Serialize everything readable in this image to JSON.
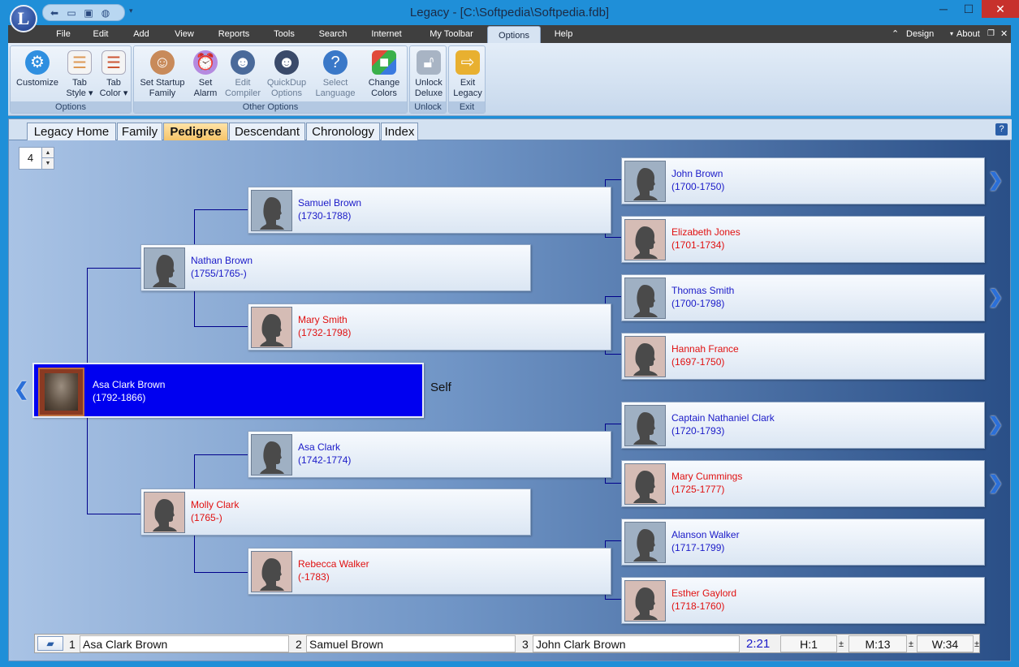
{
  "window": {
    "title": "Legacy - [C:\\Softpedia\\Softpedia.fdb]",
    "logo_letter": "L",
    "min": "─",
    "max": "☐",
    "close": "✕"
  },
  "qat": {
    "icons": [
      "back-arrow-icon",
      "folder-icon",
      "monitor-icon",
      "globe-icon"
    ],
    "dropdown": "▾"
  },
  "menu": {
    "items": [
      "File",
      "Edit",
      "Add",
      "View",
      "Reports",
      "Tools",
      "Search",
      "Internet",
      "My Toolbar",
      "Options",
      "Help"
    ],
    "active": "Options",
    "design": "Design",
    "about": "About",
    "caret": "⌃"
  },
  "ribbon": {
    "groups": [
      {
        "label": "Options",
        "buttons": [
          {
            "line1": "Customize",
            "line2": "",
            "icon": "gear-icon"
          },
          {
            "line1": "Tab",
            "line2": "Style ▾",
            "icon": "tab-style-icon"
          },
          {
            "line1": "Tab",
            "line2": "Color ▾",
            "icon": "tab-color-icon"
          }
        ]
      },
      {
        "label": "Other Options",
        "buttons": [
          {
            "line1": "Set Startup",
            "line2": "Family",
            "icon": "family-icon"
          },
          {
            "line1": "Set",
            "line2": "Alarm",
            "icon": "alarm-clock-icon"
          },
          {
            "line1": "Edit",
            "line2": "Compiler",
            "icon": "compiler-icon"
          },
          {
            "line1": "QuickDup",
            "line2": "Options",
            "icon": "quickdup-icon"
          },
          {
            "line1": "Select",
            "line2": "Language",
            "icon": "language-globe-icon"
          },
          {
            "line1": "Change",
            "line2": "Colors",
            "icon": "colors-cubes-icon"
          }
        ]
      },
      {
        "label": "Unlock",
        "buttons": [
          {
            "line1": "Unlock",
            "line2": "Deluxe",
            "icon": "padlock-icon"
          }
        ]
      },
      {
        "label": "Exit",
        "buttons": [
          {
            "line1": "Exit",
            "line2": "Legacy",
            "icon": "exit-door-icon"
          }
        ]
      }
    ]
  },
  "tabs": [
    "Legacy Home",
    "Family",
    "Pedigree",
    "Descendant",
    "Chronology",
    "Index"
  ],
  "active_tab": "Pedigree",
  "help": "?",
  "generations": {
    "value": "4",
    "up": "▲",
    "down": "▼"
  },
  "pedigree": {
    "self": {
      "name": "Asa Clark Brown",
      "dates": "(1792-1866)",
      "label": "Self"
    },
    "gen2": [
      {
        "name": "Nathan Brown",
        "dates": "(1755/1765-)",
        "sex": "male"
      },
      {
        "name": "Molly Clark",
        "dates": "(1765-)",
        "sex": "female"
      }
    ],
    "gen3": [
      {
        "name": "Samuel Brown",
        "dates": "(1730-1788)",
        "sex": "male"
      },
      {
        "name": "Mary Smith",
        "dates": "(1732-1798)",
        "sex": "female"
      },
      {
        "name": "Asa Clark",
        "dates": "(1742-1774)",
        "sex": "male"
      },
      {
        "name": "Rebecca Walker",
        "dates": "(-1783)",
        "sex": "female"
      }
    ],
    "gen4": [
      {
        "name": "John Brown",
        "dates": "(1700-1750)",
        "sex": "male"
      },
      {
        "name": "Elizabeth Jones",
        "dates": "(1701-1734)",
        "sex": "female"
      },
      {
        "name": "Thomas Smith",
        "dates": "(1700-1798)",
        "sex": "male"
      },
      {
        "name": "Hannah France",
        "dates": "(1697-1750)",
        "sex": "female"
      },
      {
        "name": "Captain Nathaniel Clark",
        "dates": "(1720-1793)",
        "sex": "male"
      },
      {
        "name": "Mary Cummings",
        "dates": "(1725-1777)",
        "sex": "female"
      },
      {
        "name": "Alanson Walker",
        "dates": "(1717-1799)",
        "sex": "male"
      },
      {
        "name": "Esther Gaylord",
        "dates": "(1718-1760)",
        "sex": "female"
      }
    ],
    "left_arrow": "❮",
    "right_arrow": "❯"
  },
  "statusbar": {
    "slot1_num": "1",
    "slot1_name": "Asa Clark Brown",
    "slot2_num": "2",
    "slot2_name": "Samuel Brown",
    "slot3_num": "3",
    "slot3_name": "John Clark Brown",
    "time": "2:21",
    "h": "H:1",
    "m": "M:13",
    "w": "W:34",
    "pm": "±"
  },
  "colors": {
    "male_text": "#1a1ac8",
    "female_text": "#e01010",
    "self_bg": "#0000f0",
    "active_tab": "#f5c46a"
  }
}
